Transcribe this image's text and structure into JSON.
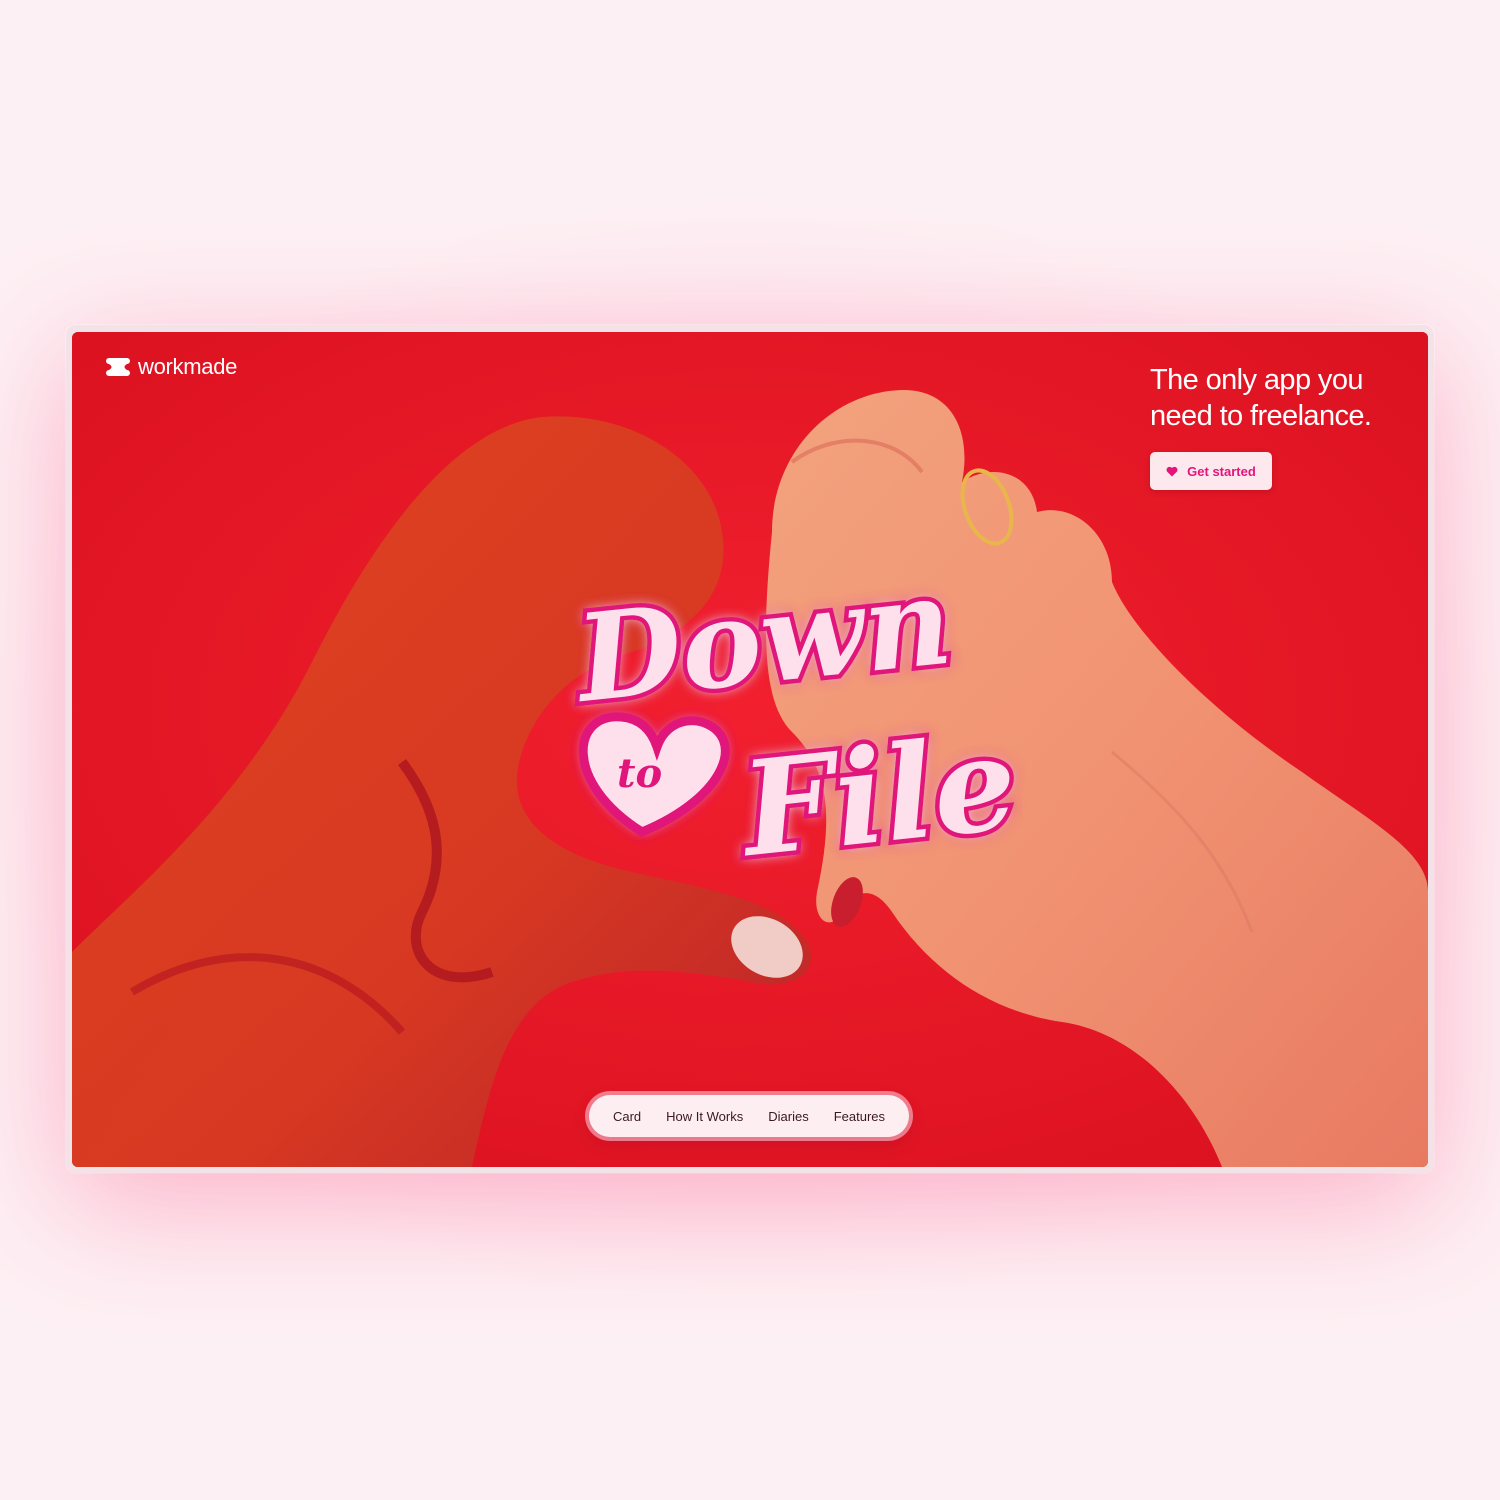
{
  "brand": {
    "name": "workmade",
    "logo_icon": "workmade-logo-icon"
  },
  "tagline": {
    "line1": "The only app you",
    "line2": "need to freelance."
  },
  "cta": {
    "label": "Get started",
    "icon": "heart-icon"
  },
  "hero": {
    "artwork": "Down to File",
    "words": {
      "word1": "Down",
      "word2": "to",
      "word3": "File"
    },
    "background_color": "#ea1a2a",
    "accent_color": "#e4147a"
  },
  "nav": {
    "items": [
      {
        "label": "Card"
      },
      {
        "label": "How It Works"
      },
      {
        "label": "Diaries"
      },
      {
        "label": "Features"
      }
    ]
  }
}
